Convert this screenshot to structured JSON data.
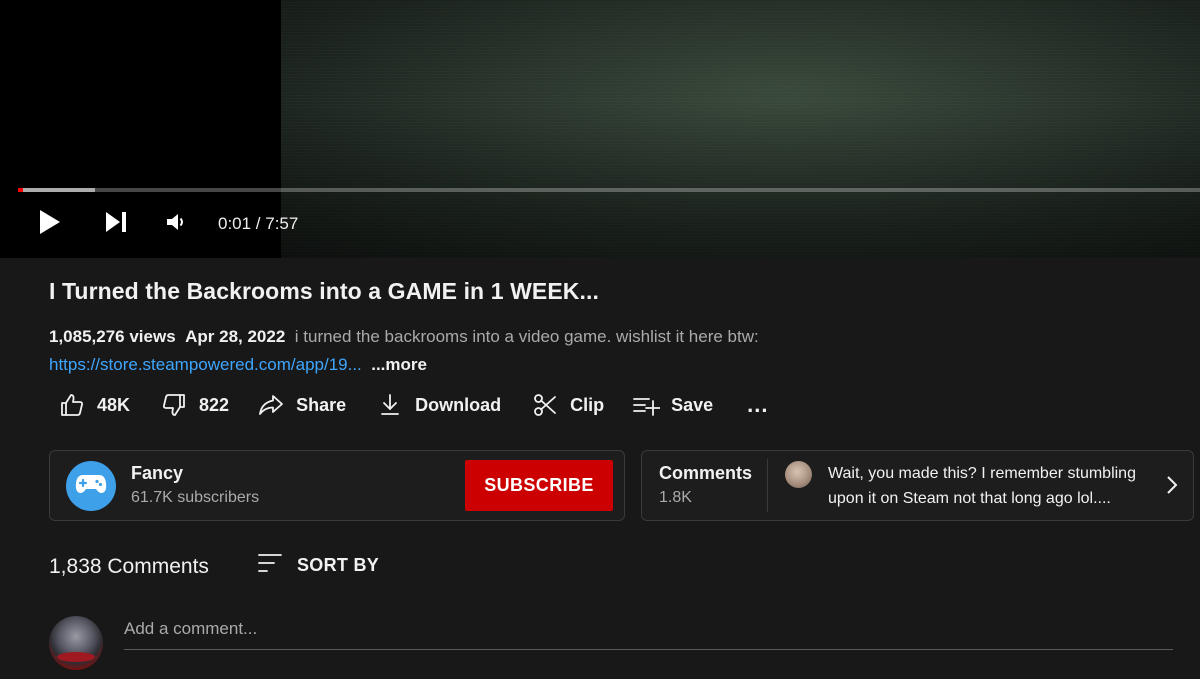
{
  "player": {
    "time_display": "0:01 / 7:57",
    "progress_fraction": 0.002,
    "buffered_fraction": 0.065
  },
  "video": {
    "title": "I Turned the Backrooms into a GAME in 1 WEEK...",
    "views": "1,085,276 views",
    "date": "Apr 28, 2022",
    "description": "i turned the backrooms into a video game.  wishlist it here btw:",
    "link": "https://store.steampowered.com/app/19...",
    "more_label": "...more"
  },
  "actions": {
    "like_count": "48K",
    "dislike_count": "822",
    "share_label": "Share",
    "download_label": "Download",
    "clip_label": "Clip",
    "save_label": "Save",
    "more_label": "..."
  },
  "channel": {
    "name": "Fancy",
    "subscribers": "61.7K subscribers",
    "subscribe_label": "SUBSCRIBE"
  },
  "comments_preview": {
    "title": "Comments",
    "count": "1.8K",
    "top_comment": "Wait, you made this? I remember stumbling upon it on Steam not that long ago lol...."
  },
  "comments": {
    "count_label": "1,838 Comments",
    "sort_label": "SORT BY",
    "add_placeholder": "Add a comment..."
  },
  "colors": {
    "background": "#181818",
    "subscribe": "#cc0000",
    "link": "#3ea6ff",
    "progress_played": "#ff0000",
    "channel_avatar": "#3ea0e8"
  },
  "icons": [
    "play-icon",
    "next-icon",
    "volume-icon",
    "thumbs-up-icon",
    "thumbs-down-icon",
    "share-icon",
    "download-icon",
    "scissors-icon",
    "playlist-add-icon",
    "more-dots-icon",
    "gamepad-icon",
    "chevron-right-icon",
    "sort-icon"
  ]
}
